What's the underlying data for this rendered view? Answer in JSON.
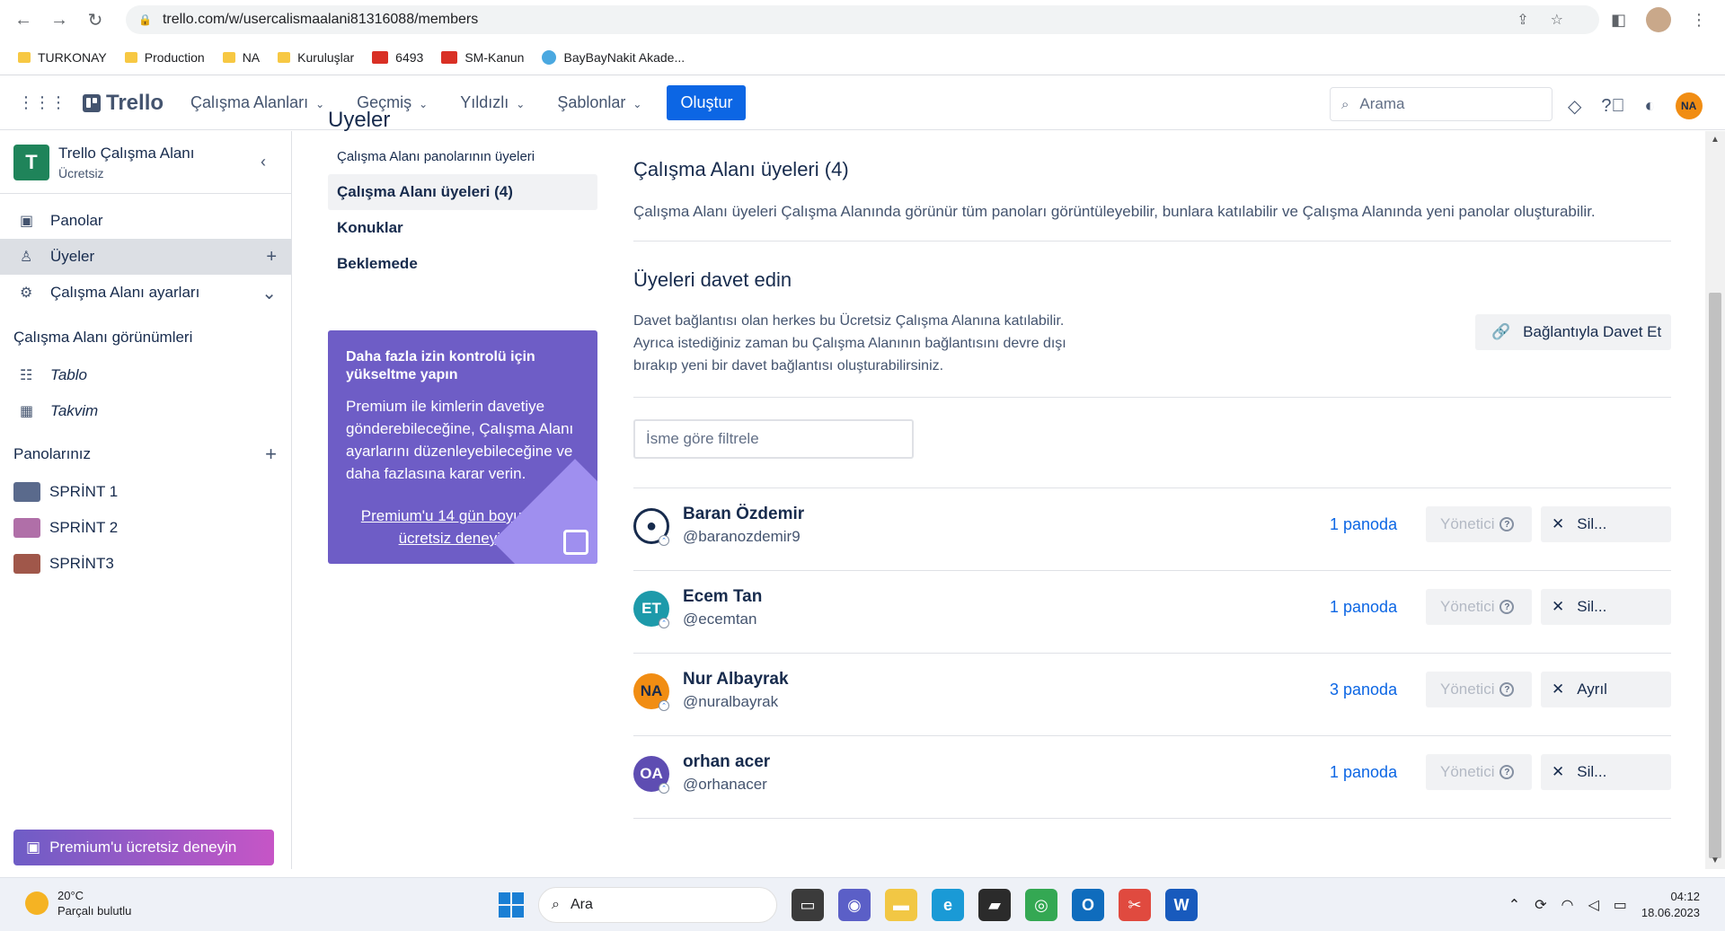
{
  "browser": {
    "url": "trello.com/w/usercalismaalani81316088/members",
    "bookmarks": [
      "TURKONAY",
      "Production",
      "NA",
      "Kuruluşlar",
      "6493",
      "SM-Kanun",
      "BayBayNakit Akade..."
    ]
  },
  "header": {
    "logo": "Trello",
    "menu": [
      {
        "label": "Çalışma Alanları"
      },
      {
        "label": "Geçmiş"
      },
      {
        "label": "Yıldızlı"
      },
      {
        "label": "Şablonlar"
      }
    ],
    "create_label": "Oluştur",
    "search_placeholder": "Arama",
    "user_initials": "NA"
  },
  "sidebar": {
    "workspace_initial": "T",
    "workspace_name": "Trello Çalışma Alanı",
    "workspace_plan": "Ücretsiz",
    "items": [
      {
        "label": "Panolar"
      },
      {
        "label": "Üyeler"
      },
      {
        "label": "Çalışma Alanı ayarları"
      }
    ],
    "views_title": "Çalışma Alanı görünümleri",
    "views": [
      {
        "label": "Tablo"
      },
      {
        "label": "Takvim"
      }
    ],
    "boards_title": "Panolarınız",
    "boards": [
      {
        "label": "SPRİNT 1",
        "color": "#5a6a8c"
      },
      {
        "label": "SPRİNT 2",
        "color": "#b06fa8"
      },
      {
        "label": "SPRİNT3",
        "color": "#a0574a"
      }
    ],
    "premium_button": "Premium'u ücretsiz deneyin"
  },
  "subnav": {
    "heading": "Üyeler",
    "items": [
      {
        "label": "Çalışma Alanı panolarının üyeleri"
      },
      {
        "label": "Çalışma Alanı üyeleri (4)"
      },
      {
        "label": "Konuklar"
      },
      {
        "label": "Beklemede"
      }
    ],
    "upsell_title": "Daha fazla izin kontrolü için yükseltme yapın",
    "upsell_text": "Premium ile kimlerin davetiye gönderebileceğine, Çalışma Alanı ayarlarını düzenleyebileceğine ve daha fazlasına karar verin.",
    "upsell_link": "Premium'u 14 gün boyunca ücretsiz deneyin"
  },
  "main": {
    "title": "Çalışma Alanı üyeleri (4)",
    "description": "Çalışma Alanı üyeleri Çalışma Alanında görünür tüm panoları görüntüleyebilir, bunlara katılabilir ve Çalışma Alanında yeni panolar oluşturabilir.",
    "invite_title": "Üyeleri davet edin",
    "invite_description": "Davet bağlantısı olan herkes bu Ücretsiz Çalışma Alanına katılabilir. Ayrıca istediğiniz zaman bu Çalışma Alanının bağlantısını devre dışı bırakıp yeni bir davet bağlantısı oluşturabilirsiniz.",
    "invite_button": "Bağlantıyla Davet Et",
    "filter_placeholder": "İsme göre filtrele",
    "members": [
      {
        "initials": "",
        "name": "Baran Özdemir",
        "username": "@baranozdemir9",
        "boards": "1 panoda",
        "role": "Yönetici",
        "action": "Sil...",
        "color": "#172b4d"
      },
      {
        "initials": "ET",
        "name": "Ecem Tan",
        "username": "@ecemtan",
        "boards": "1 panoda",
        "role": "Yönetici",
        "action": "Sil...",
        "color": "#1d9aaa"
      },
      {
        "initials": "NA",
        "name": "Nur Albayrak",
        "username": "@nuralbayrak",
        "boards": "3 panoda",
        "role": "Yönetici",
        "action": "Ayrıl",
        "color": "#f18d13"
      },
      {
        "initials": "OA",
        "name": "orhan acer",
        "username": "@orhanacer",
        "boards": "1 panoda",
        "role": "Yönetici",
        "action": "Sil...",
        "color": "#5e4db2"
      }
    ]
  },
  "taskbar": {
    "temperature": "20°C",
    "weather": "Parçalı bulutlu",
    "search_label": "Ara",
    "time": "04:12",
    "date": "18.06.2023"
  }
}
